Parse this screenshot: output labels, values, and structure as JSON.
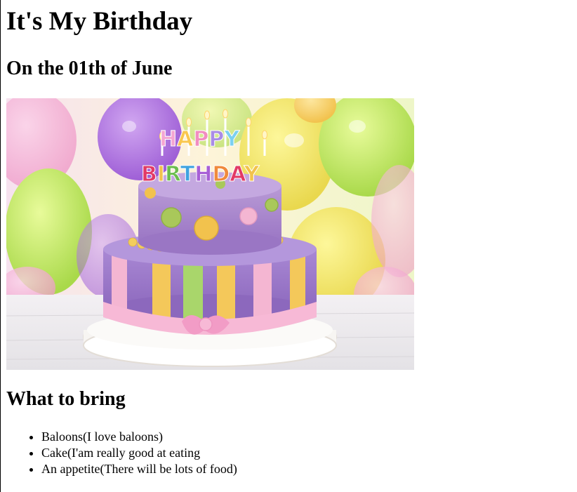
{
  "page": {
    "title": "It's My Birthday",
    "date_heading": "On the 01th of June",
    "image_alt": "Birthday cake",
    "cake_toppers": [
      "HAPPY",
      "BIRTHDAY"
    ],
    "bring_heading": "What to bring",
    "bring_items": [
      "Baloons(I love baloons)",
      "Cake(I'am really good at eating",
      "An appetite(There will be lots of food)"
    ]
  }
}
